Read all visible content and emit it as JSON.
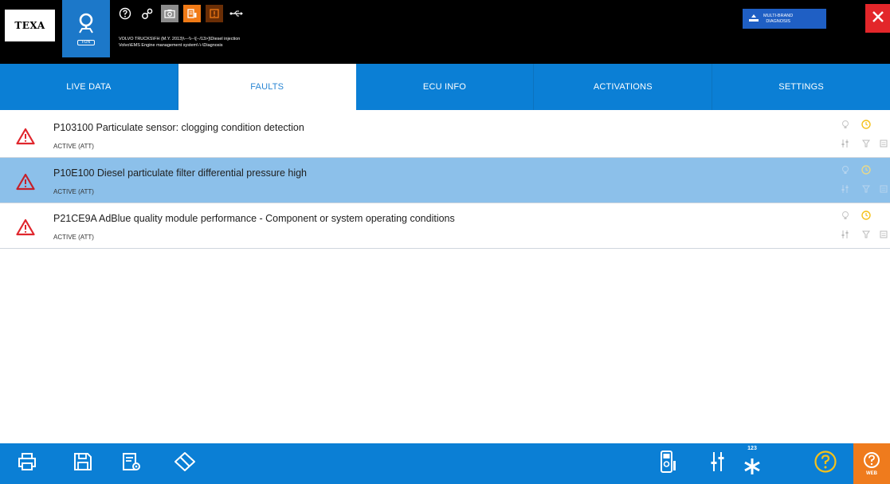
{
  "header": {
    "logo_text": "TEXA",
    "diag_mini_label": "FUN",
    "vehicle_line1": "VOLVO TRUCKS\\FH (M.Y. 2013)\\---\\\\--\\[--/13>]\\Diesel injection",
    "vehicle_line2": "Volvo\\EMS Engine management system\\-\\-\\Diagnosis",
    "multibrand_line1": "MULTI-BRAND",
    "multibrand_line2": "DIAGNOSIS"
  },
  "tabs": [
    {
      "label": "LIVE DATA"
    },
    {
      "label": "FAULTS"
    },
    {
      "label": "ECU INFO"
    },
    {
      "label": "ACTIVATIONS"
    },
    {
      "label": "SETTINGS"
    }
  ],
  "faults": [
    {
      "title": "P103100 Particulate sensor: clogging condition detection",
      "status": "ACTIVE (ATT)"
    },
    {
      "title": "P10E100 Diesel particulate filter differential pressure high",
      "status": "ACTIVE (ATT)"
    },
    {
      "title": "P21CE9A AdBlue quality module performance - Component or system operating conditions",
      "status": "ACTIVE (ATT)"
    }
  ],
  "bottom": {
    "number_label": "123",
    "web_label": "WEB"
  },
  "colors": {
    "primary_blue": "#0b7fd5",
    "selected_row": "#8cc0ea",
    "warning_red": "#e0262d",
    "accent_orange": "#ef7b1d",
    "help_yellow": "#f5c11b",
    "close_red": "#e3262a"
  },
  "icons": [
    "search-car-icon",
    "help-icon",
    "link-icon",
    "camera-icon",
    "vehicle-info-icon",
    "alert-box-icon",
    "usb-icon",
    "multibrand-icon",
    "close-icon",
    "warning-icon",
    "bulb-icon",
    "clock-icon",
    "tune-icon",
    "filter-icon",
    "list-icon",
    "print-icon",
    "save-icon",
    "report-icon",
    "erase-icon",
    "multimeter-icon",
    "sliders-icon",
    "asterisk-icon",
    "help-circle-icon",
    "web-help-icon"
  ]
}
